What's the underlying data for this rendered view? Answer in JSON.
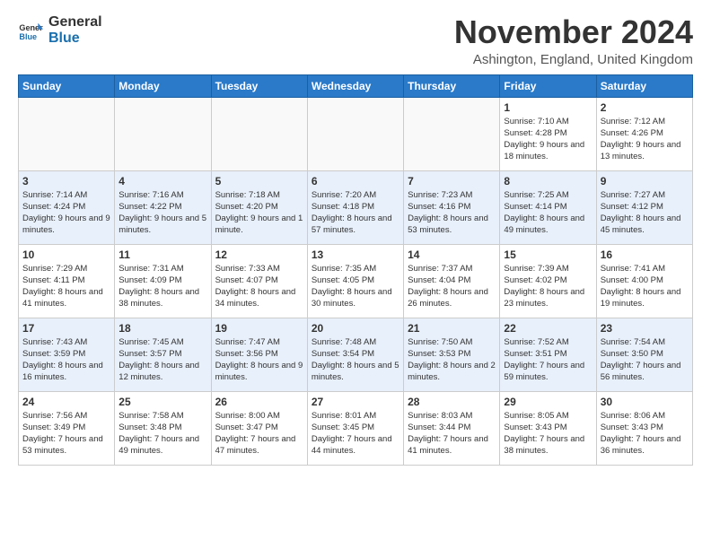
{
  "logo": {
    "line1": "General",
    "line2": "Blue"
  },
  "title": "November 2024",
  "location": "Ashington, England, United Kingdom",
  "days_of_week": [
    "Sunday",
    "Monday",
    "Tuesday",
    "Wednesday",
    "Thursday",
    "Friday",
    "Saturday"
  ],
  "weeks": [
    [
      {
        "day": "",
        "info": ""
      },
      {
        "day": "",
        "info": ""
      },
      {
        "day": "",
        "info": ""
      },
      {
        "day": "",
        "info": ""
      },
      {
        "day": "",
        "info": ""
      },
      {
        "day": "1",
        "info": "Sunrise: 7:10 AM\nSunset: 4:28 PM\nDaylight: 9 hours and 18 minutes."
      },
      {
        "day": "2",
        "info": "Sunrise: 7:12 AM\nSunset: 4:26 PM\nDaylight: 9 hours and 13 minutes."
      }
    ],
    [
      {
        "day": "3",
        "info": "Sunrise: 7:14 AM\nSunset: 4:24 PM\nDaylight: 9 hours and 9 minutes."
      },
      {
        "day": "4",
        "info": "Sunrise: 7:16 AM\nSunset: 4:22 PM\nDaylight: 9 hours and 5 minutes."
      },
      {
        "day": "5",
        "info": "Sunrise: 7:18 AM\nSunset: 4:20 PM\nDaylight: 9 hours and 1 minute."
      },
      {
        "day": "6",
        "info": "Sunrise: 7:20 AM\nSunset: 4:18 PM\nDaylight: 8 hours and 57 minutes."
      },
      {
        "day": "7",
        "info": "Sunrise: 7:23 AM\nSunset: 4:16 PM\nDaylight: 8 hours and 53 minutes."
      },
      {
        "day": "8",
        "info": "Sunrise: 7:25 AM\nSunset: 4:14 PM\nDaylight: 8 hours and 49 minutes."
      },
      {
        "day": "9",
        "info": "Sunrise: 7:27 AM\nSunset: 4:12 PM\nDaylight: 8 hours and 45 minutes."
      }
    ],
    [
      {
        "day": "10",
        "info": "Sunrise: 7:29 AM\nSunset: 4:11 PM\nDaylight: 8 hours and 41 minutes."
      },
      {
        "day": "11",
        "info": "Sunrise: 7:31 AM\nSunset: 4:09 PM\nDaylight: 8 hours and 38 minutes."
      },
      {
        "day": "12",
        "info": "Sunrise: 7:33 AM\nSunset: 4:07 PM\nDaylight: 8 hours and 34 minutes."
      },
      {
        "day": "13",
        "info": "Sunrise: 7:35 AM\nSunset: 4:05 PM\nDaylight: 8 hours and 30 minutes."
      },
      {
        "day": "14",
        "info": "Sunrise: 7:37 AM\nSunset: 4:04 PM\nDaylight: 8 hours and 26 minutes."
      },
      {
        "day": "15",
        "info": "Sunrise: 7:39 AM\nSunset: 4:02 PM\nDaylight: 8 hours and 23 minutes."
      },
      {
        "day": "16",
        "info": "Sunrise: 7:41 AM\nSunset: 4:00 PM\nDaylight: 8 hours and 19 minutes."
      }
    ],
    [
      {
        "day": "17",
        "info": "Sunrise: 7:43 AM\nSunset: 3:59 PM\nDaylight: 8 hours and 16 minutes."
      },
      {
        "day": "18",
        "info": "Sunrise: 7:45 AM\nSunset: 3:57 PM\nDaylight: 8 hours and 12 minutes."
      },
      {
        "day": "19",
        "info": "Sunrise: 7:47 AM\nSunset: 3:56 PM\nDaylight: 8 hours and 9 minutes."
      },
      {
        "day": "20",
        "info": "Sunrise: 7:48 AM\nSunset: 3:54 PM\nDaylight: 8 hours and 5 minutes."
      },
      {
        "day": "21",
        "info": "Sunrise: 7:50 AM\nSunset: 3:53 PM\nDaylight: 8 hours and 2 minutes."
      },
      {
        "day": "22",
        "info": "Sunrise: 7:52 AM\nSunset: 3:51 PM\nDaylight: 7 hours and 59 minutes."
      },
      {
        "day": "23",
        "info": "Sunrise: 7:54 AM\nSunset: 3:50 PM\nDaylight: 7 hours and 56 minutes."
      }
    ],
    [
      {
        "day": "24",
        "info": "Sunrise: 7:56 AM\nSunset: 3:49 PM\nDaylight: 7 hours and 53 minutes."
      },
      {
        "day": "25",
        "info": "Sunrise: 7:58 AM\nSunset: 3:48 PM\nDaylight: 7 hours and 49 minutes."
      },
      {
        "day": "26",
        "info": "Sunrise: 8:00 AM\nSunset: 3:47 PM\nDaylight: 7 hours and 47 minutes."
      },
      {
        "day": "27",
        "info": "Sunrise: 8:01 AM\nSunset: 3:45 PM\nDaylight: 7 hours and 44 minutes."
      },
      {
        "day": "28",
        "info": "Sunrise: 8:03 AM\nSunset: 3:44 PM\nDaylight: 7 hours and 41 minutes."
      },
      {
        "day": "29",
        "info": "Sunrise: 8:05 AM\nSunset: 3:43 PM\nDaylight: 7 hours and 38 minutes."
      },
      {
        "day": "30",
        "info": "Sunrise: 8:06 AM\nSunset: 3:43 PM\nDaylight: 7 hours and 36 minutes."
      }
    ]
  ]
}
